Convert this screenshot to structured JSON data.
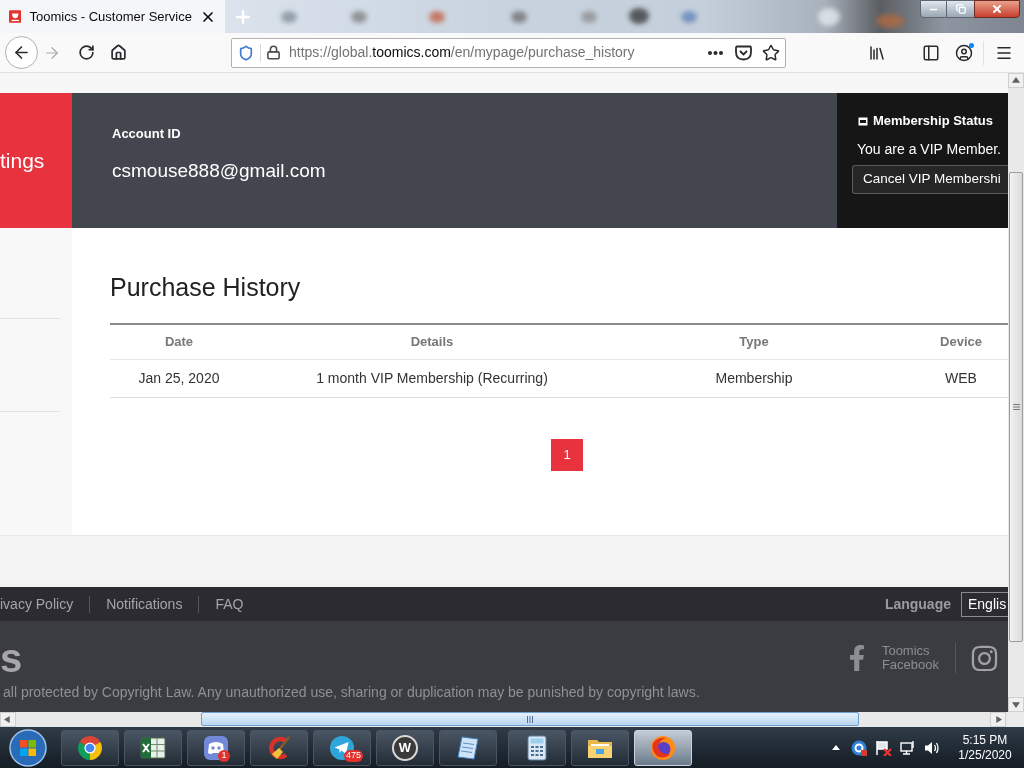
{
  "browser": {
    "tabs": [
      {
        "title": "Toomics - Customer Service",
        "selected": true
      }
    ],
    "forward_disabled": true,
    "url": "https://global.**toomics.com**/en/mypage/purchase_history"
  },
  "header": {
    "sidebar_label": "tings",
    "account_label": "Account ID",
    "account_id": "csmouse888@gmail.com",
    "membership": {
      "title": "Membership Status",
      "status": "You are a VIP Member.",
      "button": "Cancel VIP Membershi"
    }
  },
  "purchase_history": {
    "title": "Purchase History",
    "columns": [
      "Date",
      "Details",
      "Type",
      "Device"
    ],
    "rows": [
      [
        "Jan 25, 2020",
        "1 month VIP Membership (Recurring)",
        "Membership",
        "WEB"
      ]
    ],
    "pages": [
      {
        "label": "1",
        "selected": true
      }
    ]
  },
  "footer": {
    "links": [
      "ivacy Policy",
      "Notifications",
      "FAQ"
    ],
    "language_label": "Language",
    "language_value": "Englis",
    "logo": "s",
    "facebook_label": "Toomics Facebook",
    "copyright": "all protected by Copyright Law. Any unauthorized use, sharing or duplication may be punished by copyright laws."
  },
  "taskbar": {
    "apps": [
      {
        "kind": "ring",
        "selected": false
      },
      {
        "kind": "sheet",
        "selected": false
      },
      {
        "kind": "gamepad",
        "badge": "1",
        "selected": false
      },
      {
        "kind": "broom",
        "selected": false
      },
      {
        "kind": "plane",
        "badge": "475",
        "selected": false
      },
      {
        "kind": "letter",
        "label": "W",
        "selected": false
      },
      {
        "kind": "notepad",
        "selected": false
      },
      {
        "kind": "calculator",
        "selected": false
      },
      {
        "kind": "folder",
        "selected": false
      },
      {
        "kind": "flame",
        "selected": true
      }
    ],
    "clock": {
      "time": "5:15 PM",
      "date": "1/25/2020"
    }
  }
}
